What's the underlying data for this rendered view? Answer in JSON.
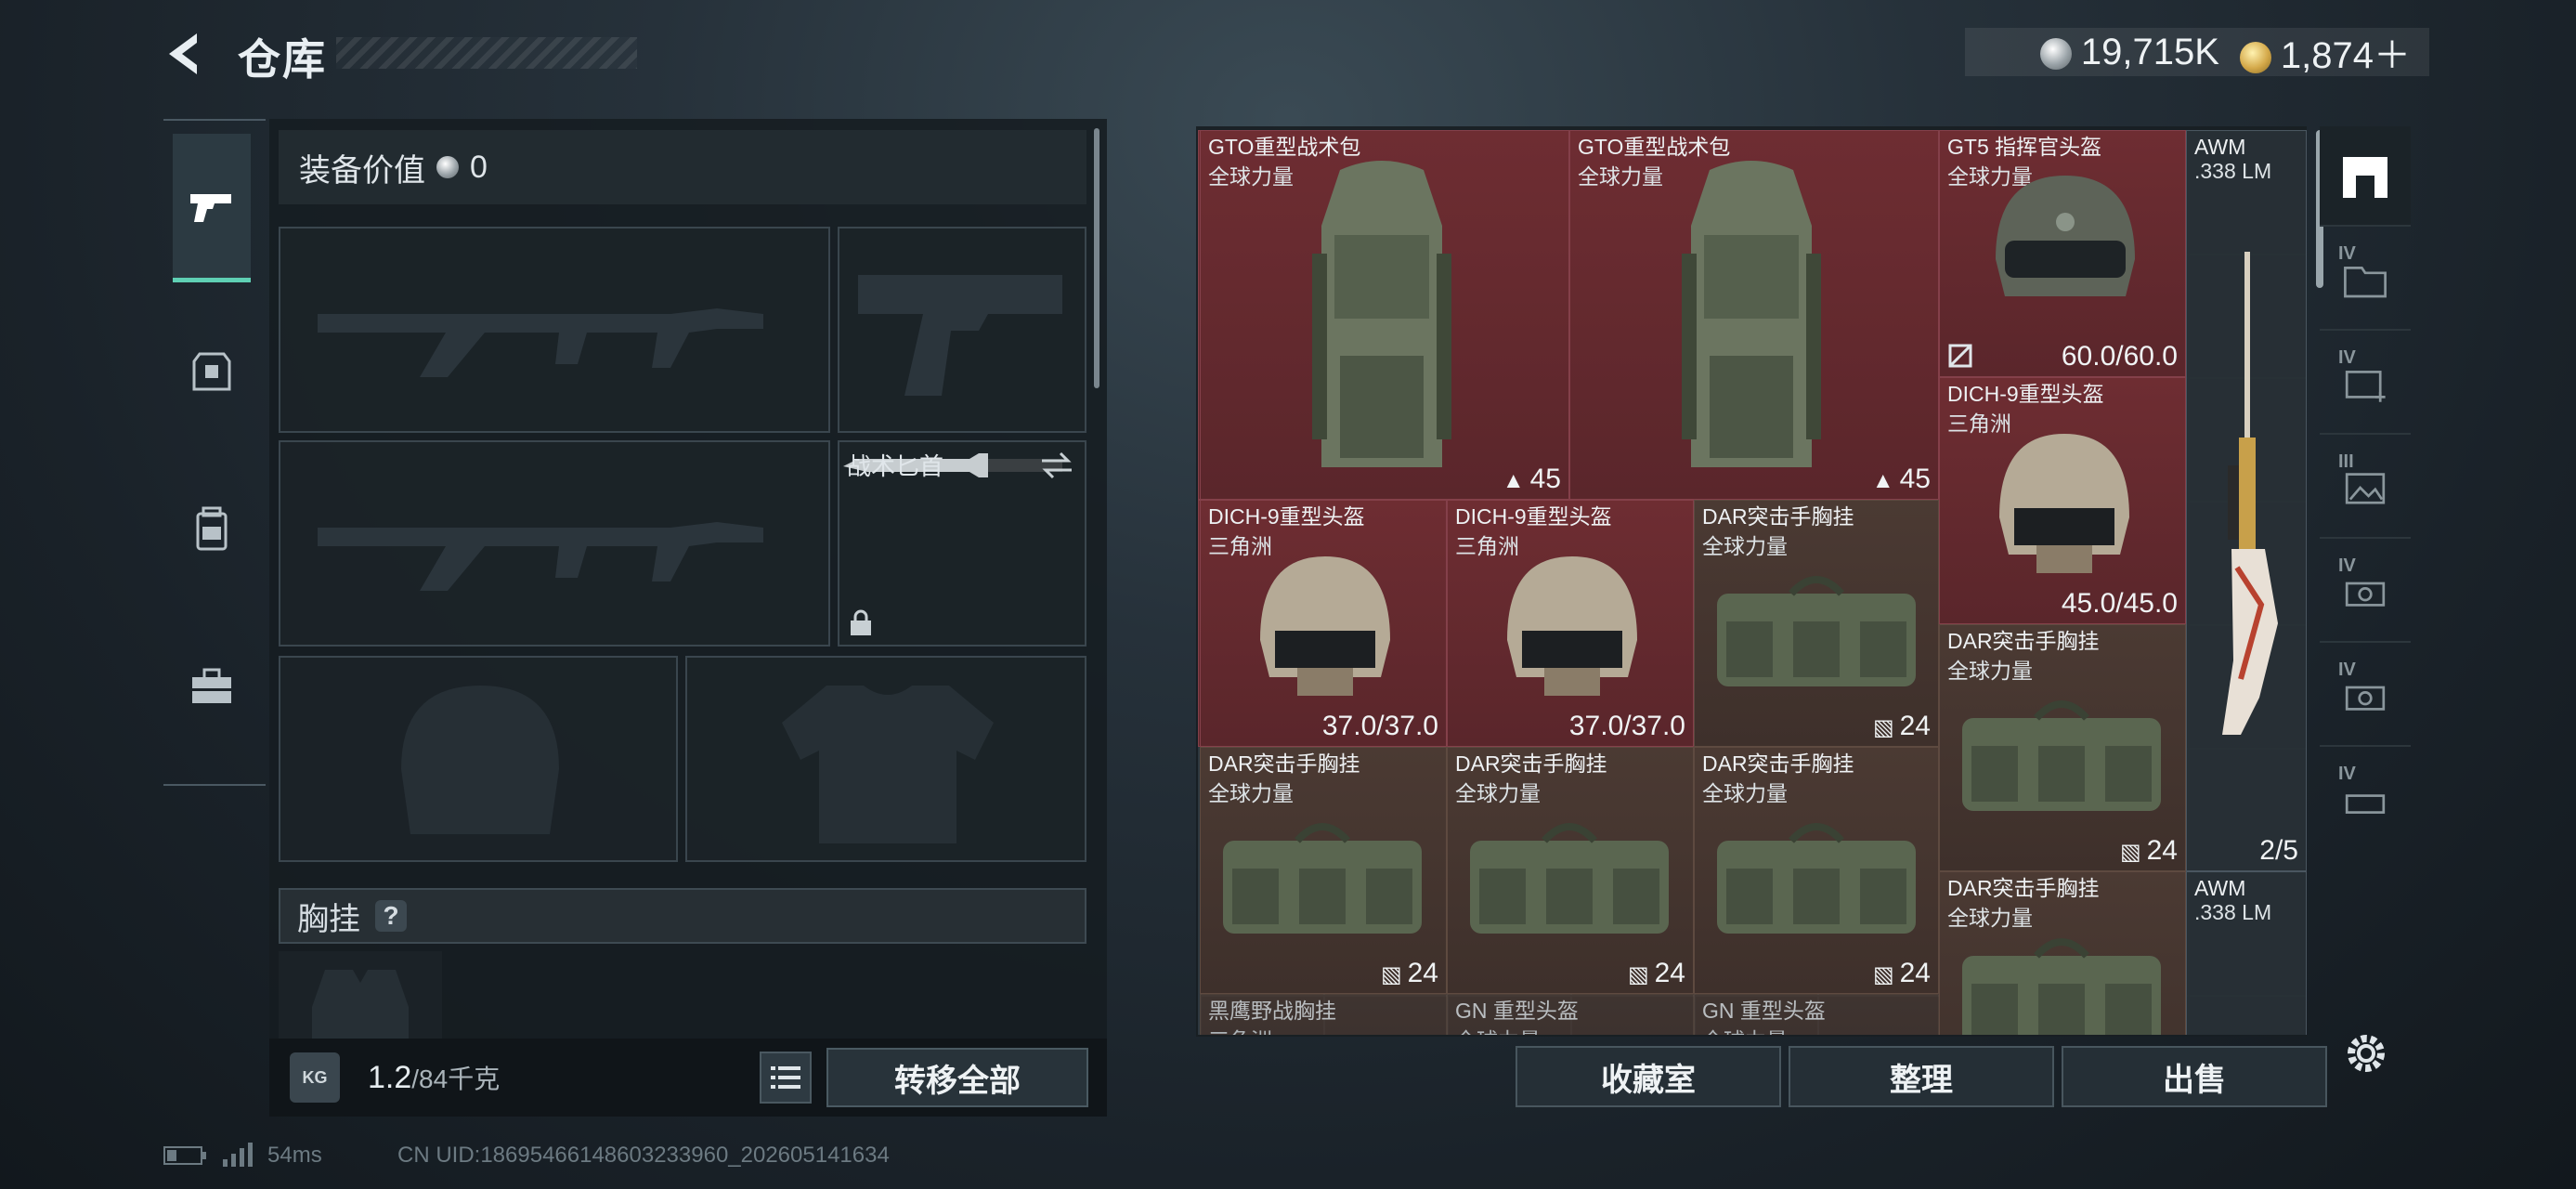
{
  "header": {
    "title": "仓库",
    "currencies": [
      {
        "icon": "silver-coin-icon",
        "value": "19,715K"
      },
      {
        "icon": "gold-coin-icon",
        "value": "1,874＋"
      }
    ]
  },
  "equipment": {
    "value_label": "装备价值",
    "value_amount": "0",
    "knife_slot_label": "战术匕首",
    "chest_rig_label": "胸挂",
    "help_label": "?",
    "weight_value": "1.2",
    "weight_capacity": "/84千克",
    "kg_icon_label": "KG",
    "transfer_all_label": "转移全部"
  },
  "categories": [
    "weapon-tab",
    "helmet-armor-tab",
    "backpack-tab",
    "toolbox-tab"
  ],
  "grid_items": [
    {
      "name": "GTO重型战术包",
      "sub": "全球力量",
      "value": "45",
      "value_icon": "backpack",
      "rarity": "red"
    },
    {
      "name": "GTO重型战术包",
      "sub": "全球力量",
      "value": "45",
      "value_icon": "backpack",
      "rarity": "red"
    },
    {
      "name": "GT5 指挥官头盔",
      "sub": "全球力量",
      "value": "60.0/60.0",
      "value_icon": "durability",
      "rarity": "red"
    },
    {
      "name": "AWM",
      "sub": ".338 LM",
      "value": "2/5",
      "value_icon": "",
      "rarity": "grey"
    },
    {
      "name": "DICH-9重型头盔",
      "sub": "三角洲",
      "value": "45.0/45.0",
      "value_icon": "",
      "rarity": "red"
    },
    {
      "name": "DICH-9重型头盔",
      "sub": "三角洲",
      "value": "37.0/37.0",
      "value_icon": "",
      "rarity": "red"
    },
    {
      "name": "DICH-9重型头盔",
      "sub": "三角洲",
      "value": "37.0/37.0",
      "value_icon": "",
      "rarity": "red"
    },
    {
      "name": "DAR突击手胸挂",
      "sub": "全球力量",
      "value": "24",
      "value_icon": "vest",
      "rarity": "brown"
    },
    {
      "name": "DAR突击手胸挂",
      "sub": "全球力量",
      "value": "24",
      "value_icon": "vest",
      "rarity": "brown"
    },
    {
      "name": "DAR突击手胸挂",
      "sub": "全球力量",
      "value": "24",
      "value_icon": "vest",
      "rarity": "brown"
    },
    {
      "name": "DAR突击手胸挂",
      "sub": "全球力量",
      "value": "24",
      "value_icon": "vest",
      "rarity": "brown"
    },
    {
      "name": "DAR突击手胸挂",
      "sub": "全球力量",
      "value": "24",
      "value_icon": "vest",
      "rarity": "brown"
    },
    {
      "name": "DAR突击手胸挂",
      "sub": "全球力量",
      "value": "",
      "value_icon": "",
      "rarity": "brown"
    },
    {
      "name": "AWM",
      "sub": ".338 LM",
      "value": "",
      "value_icon": "",
      "rarity": "grey"
    },
    {
      "name": "黑鹰野战胸挂",
      "sub": "三角洲",
      "value": "",
      "value_icon": "",
      "rarity": "brown"
    },
    {
      "name": "GN 重型头盔",
      "sub": "全球力量",
      "value": "",
      "value_icon": "",
      "rarity": "brown"
    },
    {
      "name": "GN 重型头盔",
      "sub": "全球力量",
      "value": "",
      "value_icon": "",
      "rarity": "brown"
    }
  ],
  "actions": {
    "collection_label": "收藏室",
    "sort_label": "整理",
    "sell_label": "出售"
  },
  "storage_tabs": [
    {
      "tier": "",
      "icon": "storage-main-icon"
    },
    {
      "tier": "IV",
      "icon": "storage-folder-icon"
    },
    {
      "tier": "IV",
      "icon": "storage-medical-icon"
    },
    {
      "tier": "III",
      "icon": "storage-photo-icon"
    },
    {
      "tier": "IV",
      "icon": "storage-ammo-icon"
    },
    {
      "tier": "IV",
      "icon": "storage-ammo-icon"
    },
    {
      "tier": "IV",
      "icon": "storage-key-icon"
    }
  ],
  "status": {
    "ping": "54ms",
    "uid": "CN UID:18695466148603233960_202605141634"
  },
  "colors": {
    "accent": "#5fd0b4",
    "rarity_red": "#6e2d32",
    "rarity_brown": "#4b3a33"
  }
}
